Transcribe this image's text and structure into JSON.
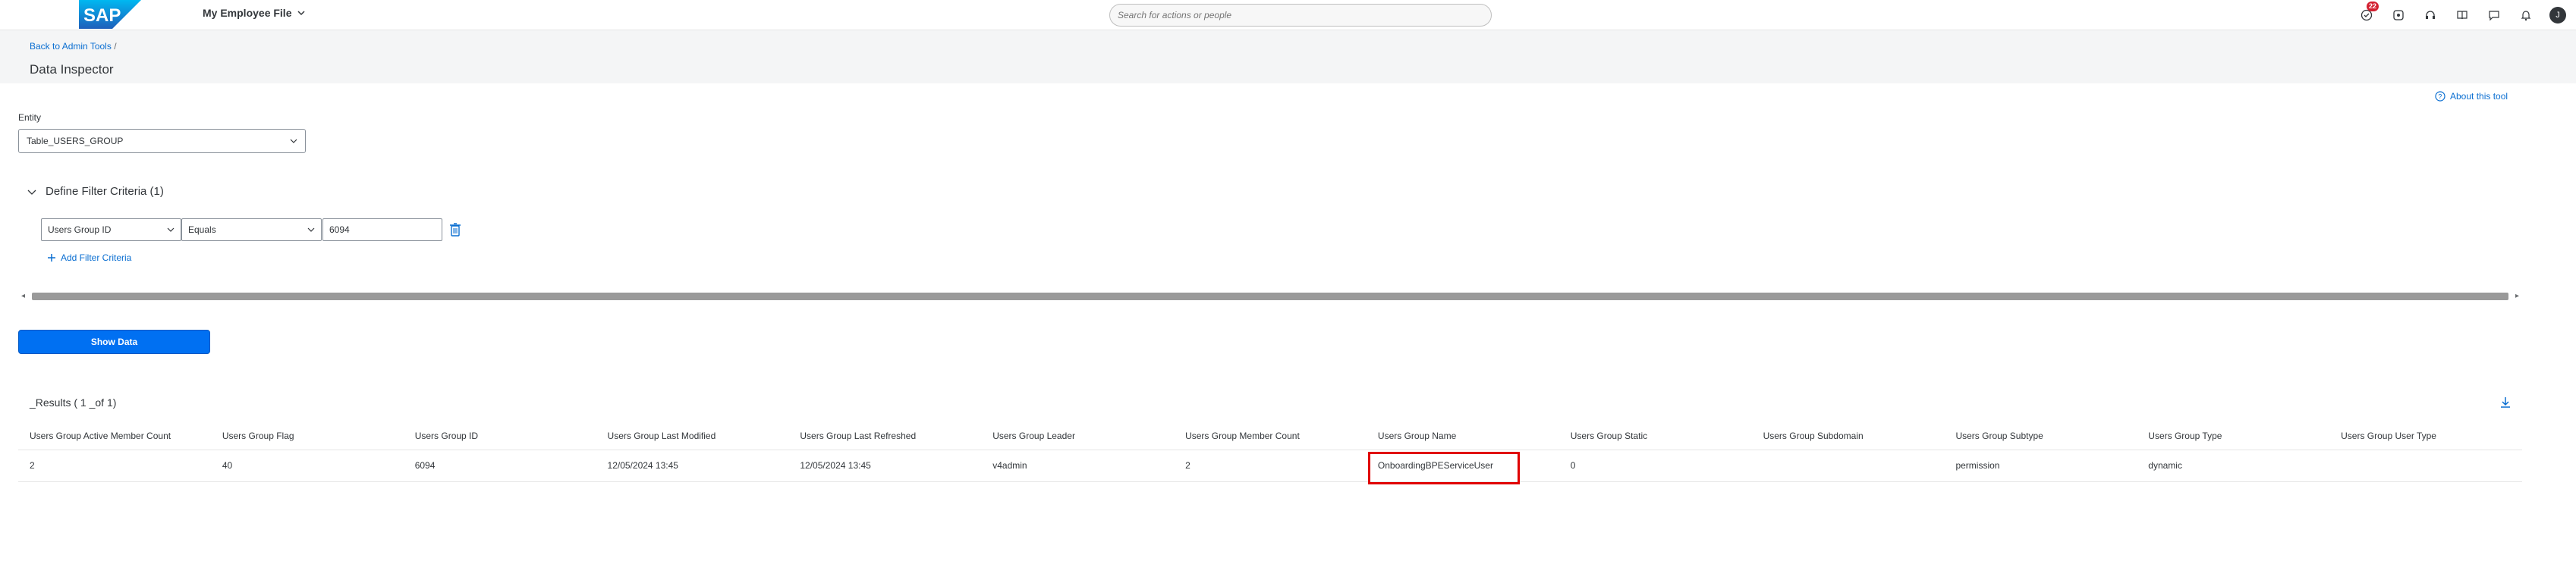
{
  "shell": {
    "logo_text": "SAP",
    "app_title": "My Employee File",
    "search_placeholder": "Search for actions or people",
    "notification_badge": "22",
    "avatar_initial": "J"
  },
  "header": {
    "breadcrumb_link": "Back to Admin Tools",
    "breadcrumb_sep": "/",
    "page_title": "Data Inspector"
  },
  "about_link": "About this tool",
  "entity": {
    "label": "Entity",
    "value": "Table_USERS_GROUP"
  },
  "filter": {
    "title": "Define Filter Criteria (1)",
    "field": "Users Group ID",
    "operator": "Equals",
    "value": "6094",
    "add_label": "Add Filter Criteria"
  },
  "show_data_label": "Show Data",
  "results": {
    "title": "_Results ( 1 _of 1)",
    "columns": [
      "Users Group Active Member Count",
      "Users Group Flag",
      "Users Group ID",
      "Users Group Last Modified",
      "Users Group Last Refreshed",
      "Users Group Leader",
      "Users Group Member Count",
      "Users Group Name",
      "Users Group Static",
      "Users Group Subdomain",
      "Users Group Subtype",
      "Users Group Type",
      "Users Group User Type"
    ],
    "rows": [
      [
        "2",
        "40",
        "6094",
        "12/05/2024 13:45",
        "12/05/2024 13:45",
        "v4admin",
        "2",
        "OnboardingBPEServiceUser",
        "0",
        "",
        "permission",
        "dynamic",
        ""
      ]
    ]
  },
  "colors": {
    "accent": "#0a6ed1",
    "button": "#0070f2",
    "highlight": "#e00000"
  }
}
